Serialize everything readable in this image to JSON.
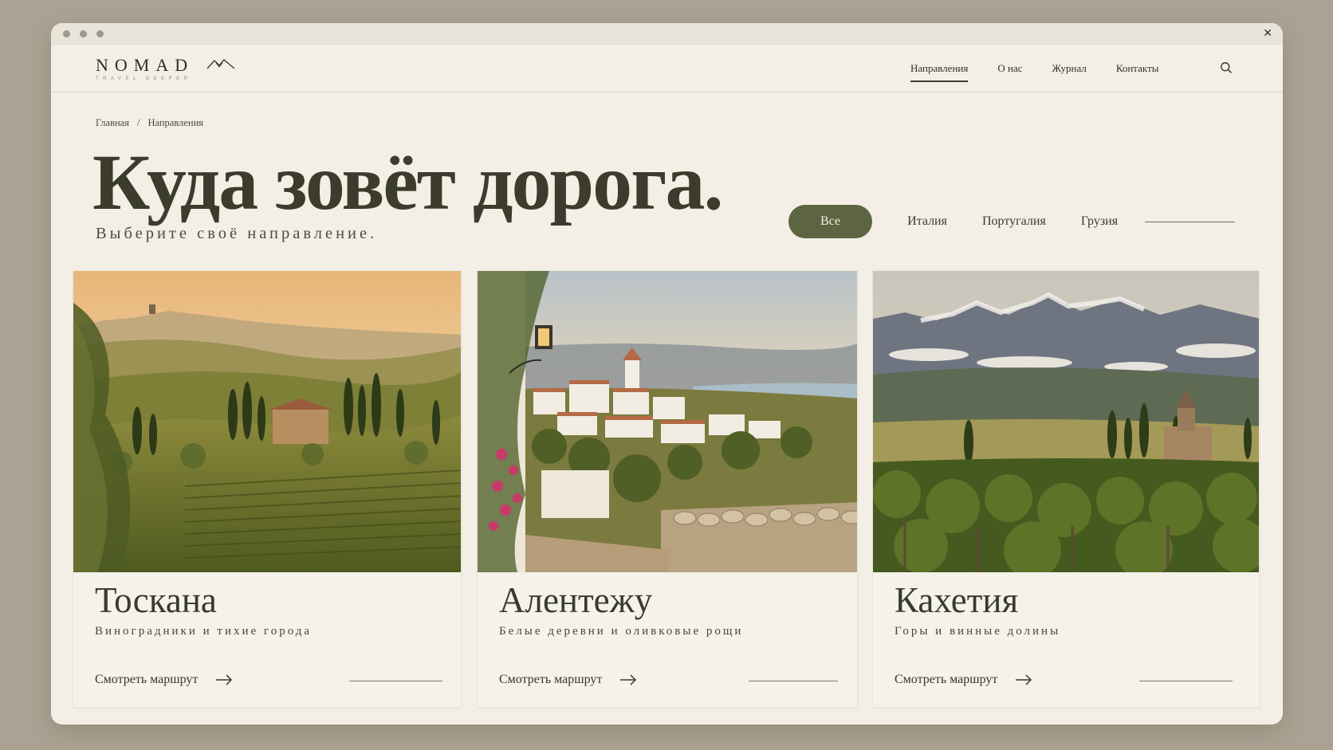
{
  "window": {
    "controls": [
      "close"
    ]
  },
  "brand": {
    "name": "NOMAD",
    "tagline": "TRAVEL DEEPER"
  },
  "nav": {
    "items": [
      {
        "label": "Направления",
        "active": true
      },
      {
        "label": "О нас",
        "active": false
      },
      {
        "label": "Журнал",
        "active": false
      },
      {
        "label": "Контакты",
        "active": false
      }
    ]
  },
  "icons": {
    "search": "search-icon",
    "close": "close-icon",
    "logo": "mountains-icon",
    "arrow": "arrow-right-icon"
  },
  "breadcrumb": {
    "home": "Главная",
    "separator": "/",
    "current": "Направления"
  },
  "hero": {
    "title": "Куда зовёт дорога.",
    "subtitle": "Выберите своё направление."
  },
  "filters": {
    "active": "Все",
    "options": [
      "Италия",
      "Португалия",
      "Грузия"
    ]
  },
  "colors": {
    "accent": "#5c6442",
    "background": "#f3efe6",
    "outer": "#aca293",
    "text": "#2f3126"
  },
  "cards": [
    {
      "title": "Тоскана",
      "subtitle": "Виноградники и тихие города",
      "cta": "Смотреть маршрут"
    },
    {
      "title": "Алентежу",
      "subtitle": "Белые деревни и оливковые рощи",
      "cta": "Смотреть маршрут"
    },
    {
      "title": "Кахетия",
      "subtitle": "Горы и винные долины",
      "cta": "Смотреть маршрут"
    }
  ]
}
